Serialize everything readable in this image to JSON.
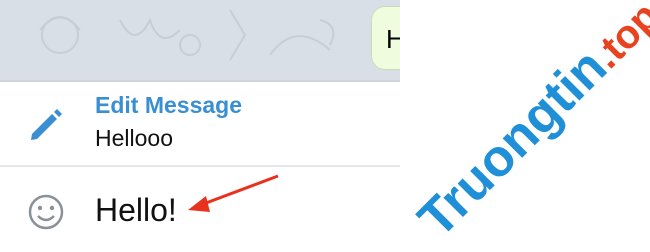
{
  "chat": {
    "bubble_text": "H"
  },
  "edit_banner": {
    "title": "Edit Message",
    "original_text": "Hellooo"
  },
  "composer": {
    "text": "Hello!"
  },
  "watermark": {
    "text_main": "Truongtin",
    "text_suffix": ".top"
  },
  "colors": {
    "accent": "#3a8fd3",
    "arrow": "#e8321e",
    "watermark_blue": "#1f8fd8",
    "watermark_red": "#e8421e"
  }
}
